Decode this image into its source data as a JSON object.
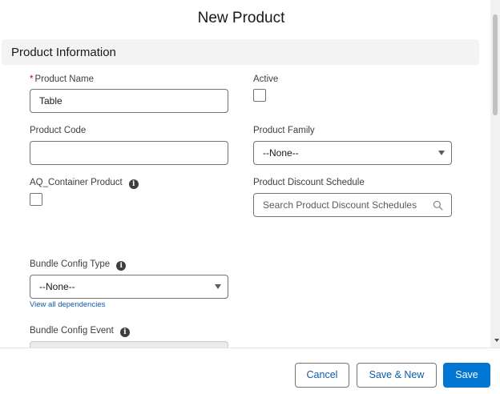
{
  "modal": {
    "title": "New Product"
  },
  "section": {
    "title": "Product Information"
  },
  "fields": {
    "product_name": {
      "label": "Product Name",
      "required_marker": "*",
      "value": "Table"
    },
    "active": {
      "label": "Active",
      "checked": false
    },
    "product_code": {
      "label": "Product Code",
      "value": ""
    },
    "product_family": {
      "label": "Product Family",
      "value": "--None--"
    },
    "aq_container_product": {
      "label": "AQ_Container Product",
      "checked": false
    },
    "product_discount_schedule": {
      "label": "Product Discount Schedule",
      "placeholder": "Search Product Discount Schedules"
    },
    "bundle_config_type": {
      "label": "Bundle Config Type",
      "value": "--None--",
      "link": "View all dependencies"
    },
    "bundle_config_event": {
      "label": "Bundle Config Event"
    }
  },
  "icons": {
    "info": "i"
  },
  "footer": {
    "cancel_label": "Cancel",
    "save_new_label": "Save & New",
    "save_label": "Save"
  },
  "colors": {
    "brand": "#0176d3",
    "link": "#0b5cab",
    "required": "#ba0517"
  }
}
